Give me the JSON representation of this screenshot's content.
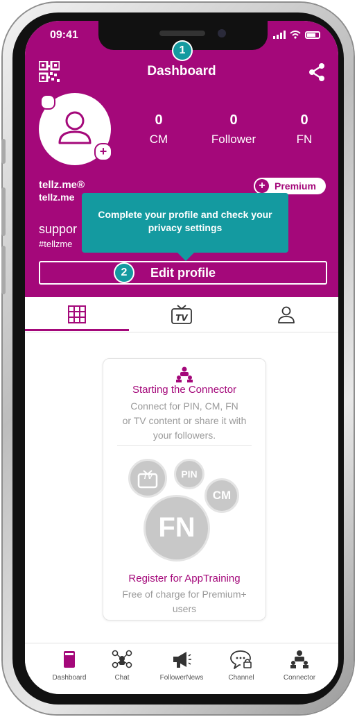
{
  "status_bar": {
    "time": "09:41"
  },
  "header": {
    "title": "Dashboard"
  },
  "stats": [
    {
      "value": "0",
      "label": "CM"
    },
    {
      "value": "0",
      "label": "Follower"
    },
    {
      "value": "0",
      "label": "FN"
    }
  ],
  "profile": {
    "name": "tellz.me®",
    "handle": "tellz.me",
    "premium_label": "Premium",
    "premium_plus": "+",
    "support_text": "suppor",
    "hashtag_text": "#tellzme",
    "avatar_plus": "+"
  },
  "tooltip": {
    "text": "Complete your profile and check your privacy settings"
  },
  "markers": {
    "one": "1",
    "two": "2"
  },
  "edit_button": {
    "label": "Edit profile"
  },
  "tabs": {
    "active_index": 0,
    "items": [
      "grid-icon",
      "tv-icon",
      "person-icon"
    ]
  },
  "connector_card": {
    "title": "Starting the Connector",
    "description_line1": "Connect for PIN, CM, FN",
    "description_line2": "or TV content or share it with",
    "description_line3": "your followers.",
    "badges": {
      "tv": "TV",
      "pin": "PIN",
      "cm": "CM",
      "fn": "FN"
    },
    "training_title": "Register for AppTraining",
    "training_line1": "Free of charge for Premium+",
    "training_line2": "users"
  },
  "bottom_nav": [
    {
      "label": "Dashboard",
      "icon": "dashboard-icon"
    },
    {
      "label": "Chat",
      "icon": "chat-icon"
    },
    {
      "label": "FollowerNews",
      "icon": "megaphone-icon"
    },
    {
      "label": "Channel",
      "icon": "channel-icon"
    },
    {
      "label": "Connector",
      "icon": "connector-icon"
    }
  ],
  "colors": {
    "brand": "#a4087a",
    "tooltip": "#149aa0",
    "muted": "#9a9a9a"
  }
}
